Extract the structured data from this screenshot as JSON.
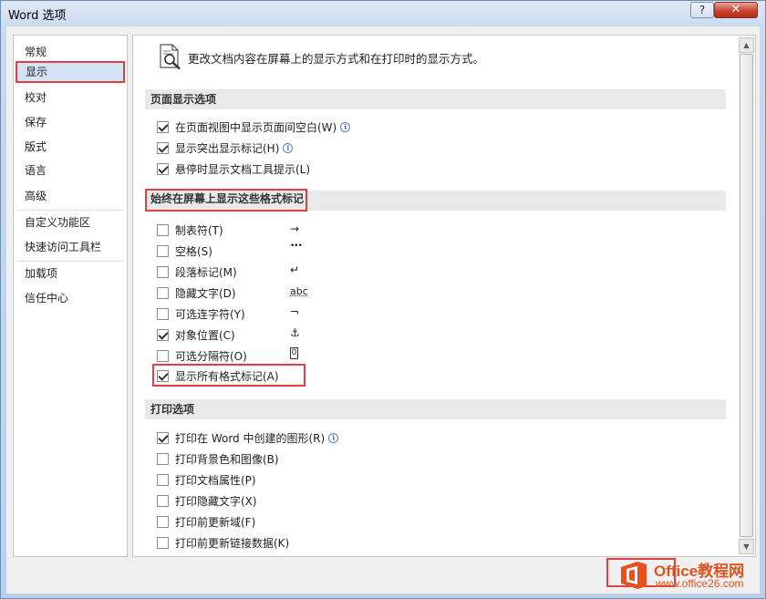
{
  "window": {
    "title": "Word 选项",
    "help_label": "?",
    "close_label": "✕"
  },
  "sidebar": {
    "items": [
      {
        "label": "常规",
        "active": false
      },
      {
        "label": "显示",
        "active": true
      },
      {
        "label": "校对",
        "active": false
      },
      {
        "label": "保存",
        "active": false
      },
      {
        "label": "版式",
        "active": false
      },
      {
        "label": "语言",
        "active": false
      },
      {
        "label": "高级",
        "active": false
      },
      {
        "label": "自定义功能区",
        "active": false
      },
      {
        "label": "快速访问工具栏",
        "active": false
      },
      {
        "label": "加载项",
        "active": false
      },
      {
        "label": "信任中心",
        "active": false
      }
    ]
  },
  "main": {
    "header_text": "更改文档内容在屏幕上的显示方式和在打印时的显示方式。",
    "section_page": "页面显示选项",
    "page_options": [
      {
        "label": "在页面视图中显示页面间空白(W)",
        "checked": true,
        "info": true
      },
      {
        "label": "显示突出显示标记(H)",
        "checked": true,
        "info": true
      },
      {
        "label": "悬停时显示文档工具提示(L)",
        "checked": true,
        "info": false
      }
    ],
    "section_marks": "始终在屏幕上显示这些格式标记",
    "mark_options": [
      {
        "label": "制表符(T)",
        "checked": false,
        "symbol": "→"
      },
      {
        "label": "空格(S)",
        "checked": false,
        "symbol": "•••"
      },
      {
        "label": "段落标记(M)",
        "checked": false,
        "symbol": "↵"
      },
      {
        "label": "隐藏文字(D)",
        "checked": false,
        "symbol": "abc"
      },
      {
        "label": "可选连字符(Y)",
        "checked": false,
        "symbol": "¬"
      },
      {
        "label": "对象位置(C)",
        "checked": true,
        "symbol": "⚓"
      },
      {
        "label": "可选分隔符(O)",
        "checked": false,
        "symbol": "0"
      },
      {
        "label": "显示所有格式标记(A)",
        "checked": true,
        "symbol": ""
      }
    ],
    "section_print": "打印选项",
    "print_options": [
      {
        "label": "打印在 Word 中创建的图形(R)",
        "checked": true,
        "info": true
      },
      {
        "label": "打印背景色和图像(B)",
        "checked": false,
        "info": false
      },
      {
        "label": "打印文档属性(P)",
        "checked": false,
        "info": false
      },
      {
        "label": "打印隐藏文字(X)",
        "checked": false,
        "info": false
      },
      {
        "label": "打印前更新域(F)",
        "checked": false,
        "info": false
      },
      {
        "label": "打印前更新链接数据(K)",
        "checked": false,
        "info": false
      }
    ]
  },
  "watermark": {
    "line1": "Office教程网",
    "line2": "www.office26.com"
  },
  "colors": {
    "highlight": "#e04040",
    "active_bg": "#d5e3f6",
    "section_bg": "#e9e9e9",
    "watermark": "#e0531f"
  },
  "icons": {
    "header": "magnifier-document-icon",
    "info": "info-icon",
    "logo": "office-logo-icon"
  }
}
